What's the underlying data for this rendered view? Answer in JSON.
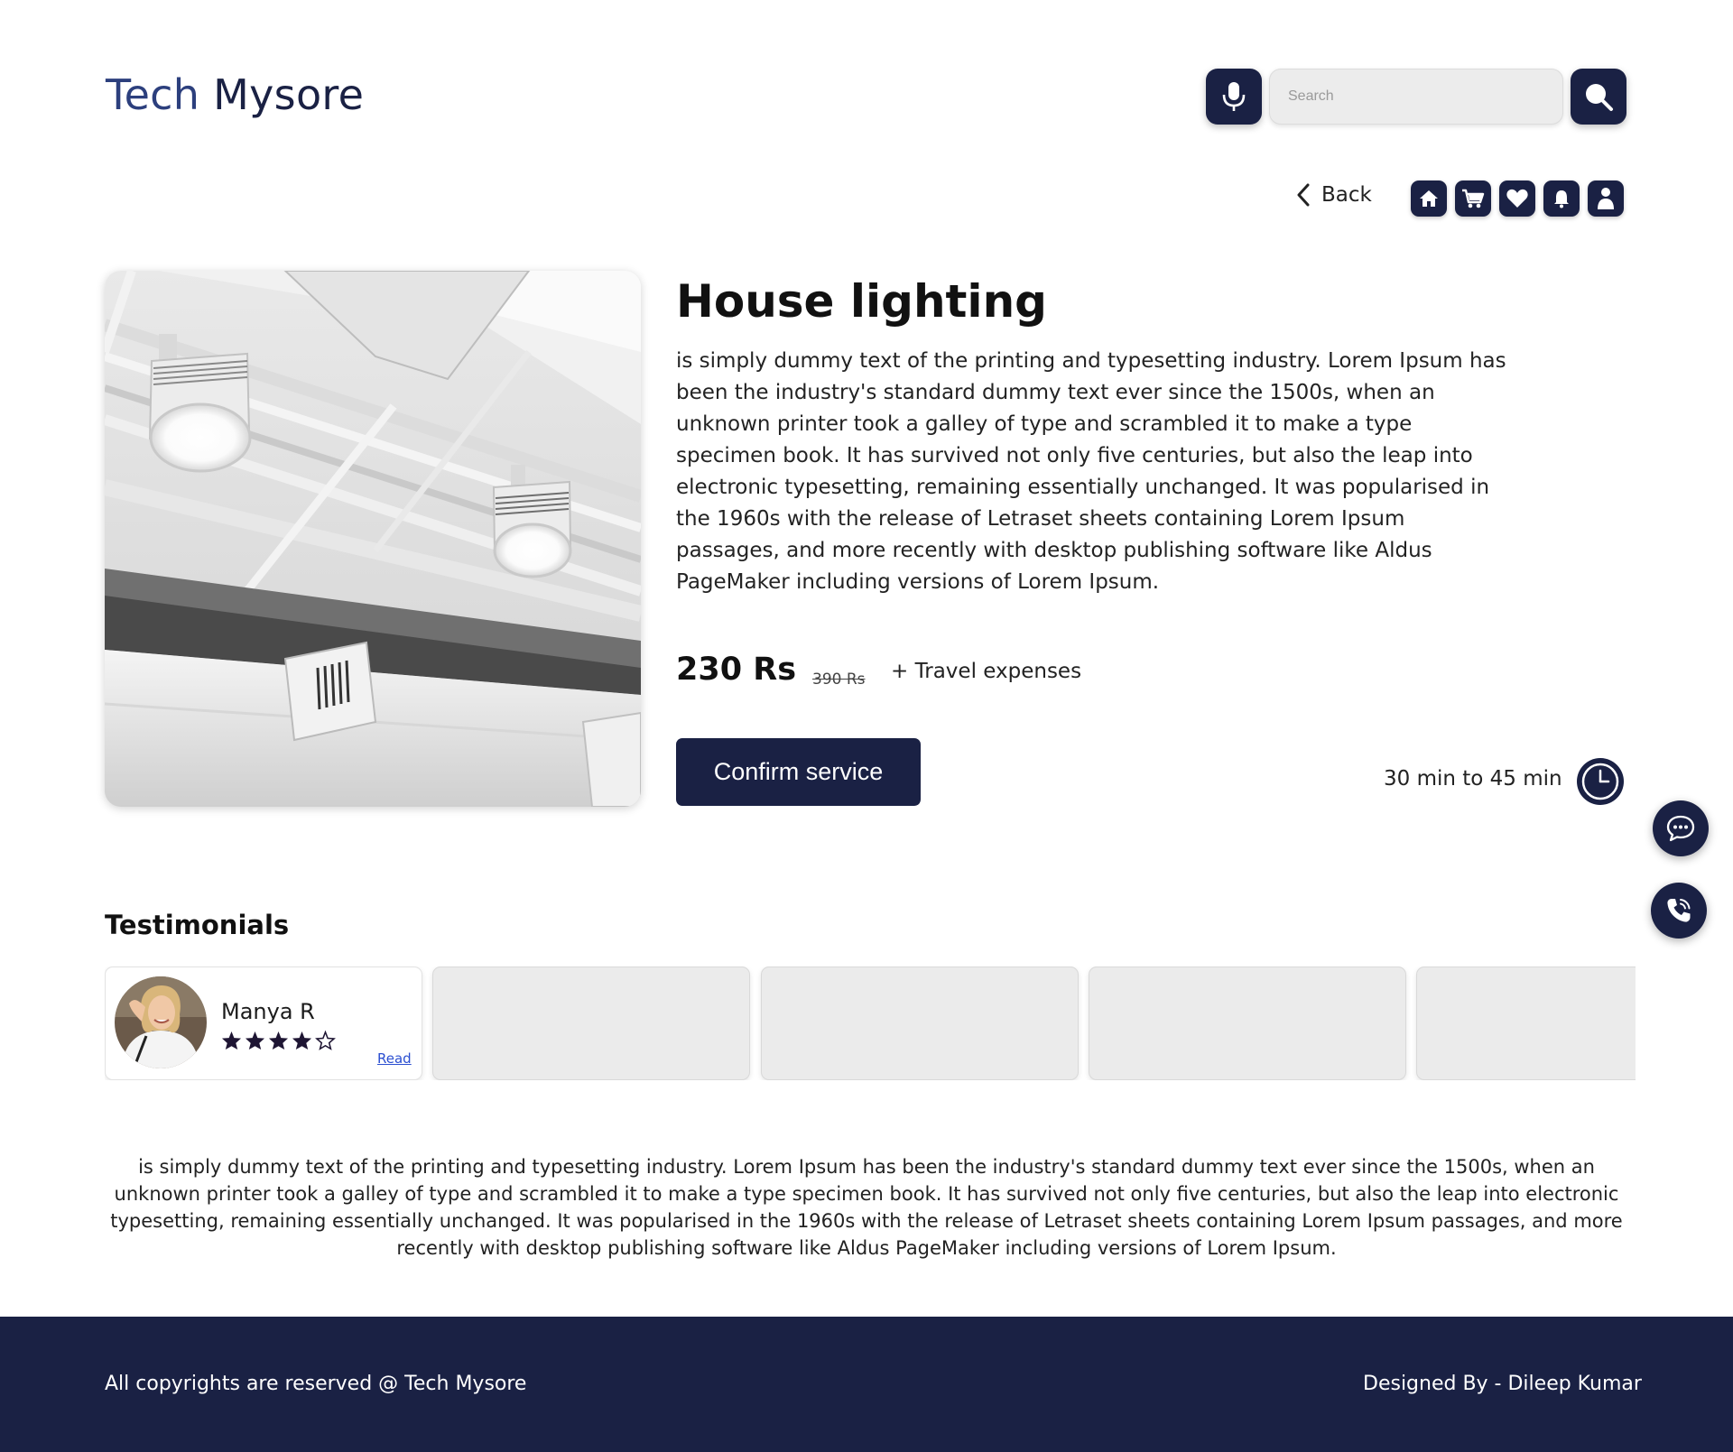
{
  "header": {
    "brand_first": "Tech",
    "brand_second": "Mysore",
    "search_placeholder": "Search",
    "mic_icon": "microphone-icon",
    "search_icon": "search-icon"
  },
  "nav": {
    "back_label": "Back",
    "icons": [
      "home-icon",
      "cart-icon",
      "heart-icon",
      "bell-icon",
      "user-icon"
    ]
  },
  "product": {
    "title": "House lighting",
    "description": "is simply dummy text of the printing and typesetting industry. Lorem Ipsum has been the industry's standard dummy text ever since the 1500s, when an unknown printer took a galley of type and scrambled it to make a type specimen book. It has survived not only five centuries, but also the leap into electronic typesetting, remaining essentially unchanged. It was popularised in the 1960s with the release of Letraset sheets containing Lorem Ipsum passages, and more recently with desktop publishing software like Aldus PageMaker including versions of Lorem Ipsum.",
    "price": "230 Rs",
    "old_price": "390 Rs",
    "extra_cost": "+ Travel expenses",
    "confirm_label": "Confirm service",
    "duration": "30 min to 45 min"
  },
  "testimonials": {
    "heading": "Testimonials",
    "items": [
      {
        "name": "Manya R",
        "rating": 4,
        "max_rating": 5,
        "read_label": "Read"
      }
    ]
  },
  "about": "is simply dummy text of the printing and typesetting industry. Lorem Ipsum has been the industry's standard dummy text ever since the 1500s, when an unknown printer took a galley of type and scrambled it to make a type specimen book. It has survived not only five centuries, but also the leap into electronic typesetting, remaining essentially unchanged. It was popularised in the 1960s with the release of Letraset sheets containing Lorem Ipsum passages, and more recently with desktop publishing software like Aldus PageMaker including versions of Lorem Ipsum.",
  "footer": {
    "copyright": "All copyrights are reserved @ Tech Mysore",
    "designer": "Designed By - Dileep Kumar"
  },
  "colors": {
    "navy": "#1a2144",
    "star": "#1e1533",
    "link": "#2b4fd1"
  }
}
